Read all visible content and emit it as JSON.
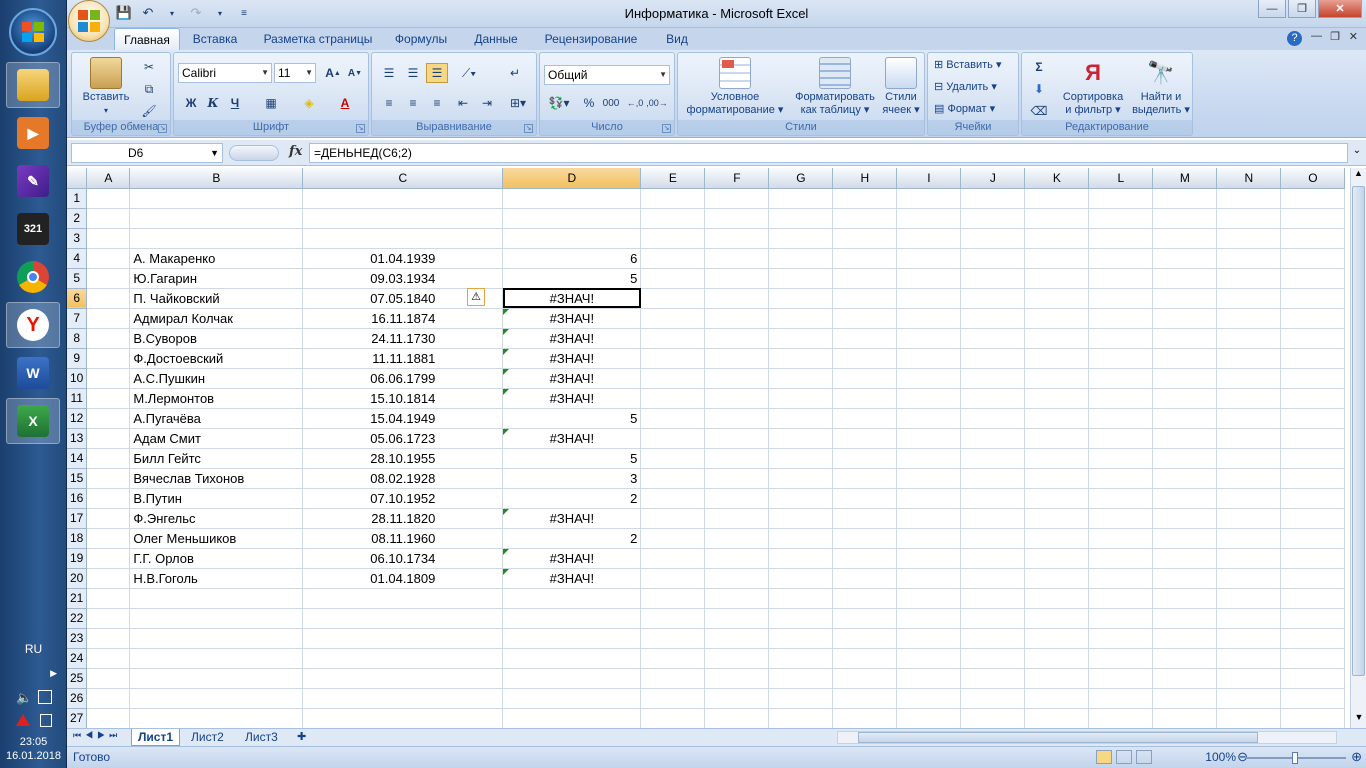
{
  "window": {
    "title": "Информатика - Microsoft Excel"
  },
  "taskbar": {
    "icons": [
      "explorer-icon",
      "media-player-icon",
      "app-icon",
      "video-321-icon",
      "chrome-icon",
      "yandex-icon",
      "word-icon",
      "excel-icon"
    ],
    "lang": "RU",
    "time": "23:05",
    "date": "16.01.2018"
  },
  "ribbon": {
    "tabs": [
      "Главная",
      "Вставка",
      "Разметка страницы",
      "Формулы",
      "Данные",
      "Рецензирование",
      "Вид"
    ],
    "clipboard": {
      "paste": "Вставить",
      "label": "Буфер обмена"
    },
    "font": {
      "name": "Calibri",
      "size": "11",
      "label": "Шрифт",
      "bold": "Ж",
      "italic": "К",
      "underline": "Ч"
    },
    "alignment": {
      "label": "Выравнивание"
    },
    "number": {
      "format": "Общий",
      "label": "Число",
      "percent": "%",
      "thousands": "000"
    },
    "styles": {
      "conditional_line1": "Условное",
      "conditional_line2": "форматирование",
      "table_line1": "Форматировать",
      "table_line2": "как таблицу",
      "cell_line1": "Стили",
      "cell_line2": "ячеек",
      "label": "Стили"
    },
    "cells": {
      "insert": "Вставить",
      "delete": "Удалить",
      "format": "Формат",
      "label": "Ячейки"
    },
    "editing": {
      "sort_line1": "Сортировка",
      "sort_line2": "и фильтр",
      "find_line1": "Найти и",
      "find_line2": "выделить",
      "label": "Редактирование"
    }
  },
  "formula_bar": {
    "name_box": "D6",
    "fx": "fx",
    "formula": "=ДЕНЬНЕД(C6;2)"
  },
  "columns": [
    "A",
    "B",
    "C",
    "D",
    "E",
    "F",
    "G",
    "H",
    "I",
    "J",
    "K",
    "L",
    "M",
    "N",
    "O"
  ],
  "selected_cell": "D6",
  "rows": [
    {
      "n": "1",
      "b": "",
      "c": "",
      "d": ""
    },
    {
      "n": "2",
      "b": "",
      "c": "",
      "d": ""
    },
    {
      "n": "3",
      "b": "",
      "c": "",
      "d": ""
    },
    {
      "n": "4",
      "b": "А. Макаренко",
      "c": "01.04.1939",
      "d": "6"
    },
    {
      "n": "5",
      "b": "Ю.Гагарин",
      "c": "09.03.1934",
      "d": "5"
    },
    {
      "n": "6",
      "b": "П. Чайковский",
      "c": "07.05.1840",
      "d": "#ЗНАЧ!"
    },
    {
      "n": "7",
      "b": "Адмирал Колчак",
      "c": "16.11.1874",
      "d": "#ЗНАЧ!"
    },
    {
      "n": "8",
      "b": "В.Суворов",
      "c": "24.11.1730",
      "d": "#ЗНАЧ!"
    },
    {
      "n": "9",
      "b": "Ф.Достоевский",
      "c": "11.11.1881",
      "d": "#ЗНАЧ!"
    },
    {
      "n": "10",
      "b": "А.С.Пушкин",
      "c": "06.06.1799",
      "d": "#ЗНАЧ!"
    },
    {
      "n": "11",
      "b": "М.Лермонтов",
      "c": "15.10.1814",
      "d": "#ЗНАЧ!"
    },
    {
      "n": "12",
      "b": "А.Пугачёва",
      "c": "15.04.1949",
      "d": "5"
    },
    {
      "n": "13",
      "b": "Адам Смит",
      "c": "05.06.1723",
      "d": "#ЗНАЧ!"
    },
    {
      "n": "14",
      "b": "Билл Гейтс",
      "c": "28.10.1955",
      "d": "5"
    },
    {
      "n": "15",
      "b": "Вячеслав Тихонов",
      "c": "08.02.1928",
      "d": "3"
    },
    {
      "n": "16",
      "b": "В.Путин",
      "c": "07.10.1952",
      "d": "2"
    },
    {
      "n": "17",
      "b": "Ф.Энгельс",
      "c": "28.11.1820",
      "d": "#ЗНАЧ!"
    },
    {
      "n": "18",
      "b": "Олег Меньшиков",
      "c": "08.11.1960",
      "d": "2"
    },
    {
      "n": "19",
      "b": "Г.Г. Орлов",
      "c": "06.10.1734",
      "d": "#ЗНАЧ!"
    },
    {
      "n": "20",
      "b": "Н.В.Гоголь",
      "c": "01.04.1809",
      "d": "#ЗНАЧ!"
    },
    {
      "n": "21",
      "b": "",
      "c": "",
      "d": ""
    },
    {
      "n": "22",
      "b": "",
      "c": "",
      "d": ""
    },
    {
      "n": "23",
      "b": "",
      "c": "",
      "d": ""
    },
    {
      "n": "24",
      "b": "",
      "c": "",
      "d": ""
    },
    {
      "n": "25",
      "b": "",
      "c": "",
      "d": ""
    },
    {
      "n": "26",
      "b": "",
      "c": "",
      "d": ""
    },
    {
      "n": "27",
      "b": "",
      "c": "",
      "d": ""
    }
  ],
  "sheets": [
    "Лист1",
    "Лист2",
    "Лист3"
  ],
  "active_sheet": "Лист1",
  "status": {
    "ready": "Готово",
    "zoom": "100%"
  }
}
